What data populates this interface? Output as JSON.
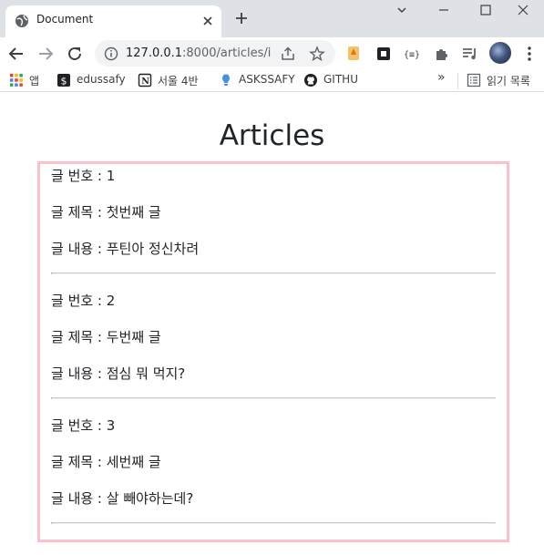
{
  "browser": {
    "tab_title": "Document",
    "url_host": "127.0.0.1",
    "url_rest": ":8000/articles/i...",
    "bookmarks": [
      {
        "label": "앱",
        "icon": "apps-grid-icon"
      },
      {
        "label": "edussafy",
        "icon": "dollar-bookmark-icon"
      },
      {
        "label": "서울 4반",
        "icon": "notion-icon"
      },
      {
        "label": "ASKSSAFY",
        "icon": "lightbulb-icon"
      },
      {
        "label": "GITHU",
        "icon": "github-icon"
      }
    ],
    "more_bookmarks": "»",
    "reading_list": "읽기 목록"
  },
  "page": {
    "title": "Articles",
    "articles": [
      {
        "number_line": "글 번호 : 1",
        "title_line": "글 제목 : 첫번째 글",
        "content_line": "글 내용 : 푸틴아 정신차려"
      },
      {
        "number_line": "글 번호 : 2",
        "title_line": "글 제목 : 두번째 글",
        "content_line": "글 내용 : 점심 뭐 먹지?"
      },
      {
        "number_line": "글 번호 : 3",
        "title_line": "글 제목 : 세번째 글",
        "content_line": "글 내용 : 살 빼야하는데?"
      }
    ]
  },
  "colors": {
    "box_border": "#ffc0cb",
    "tabstrip_bg": "#dee1e6"
  }
}
